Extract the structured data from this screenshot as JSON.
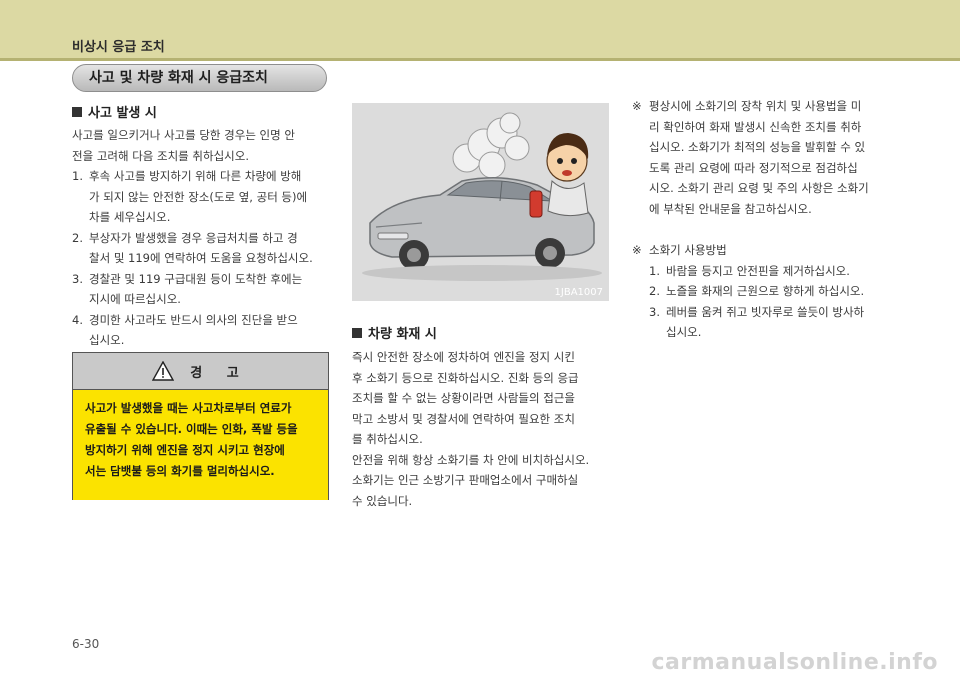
{
  "header": {
    "title": "비상시 응급 조치"
  },
  "section_title": "사고 및 차량 화재 시 응급조치",
  "accident": {
    "heading": "사고 발생 시",
    "intro": [
      "사고를 일으키거나 사고를 당한 경우는 인명 안",
      "전을 고려해 다음 조치를 취하십시오."
    ],
    "items": [
      {
        "num": "1.",
        "lines": [
          "후속 사고를 방지하기 위해 다른 차량에 방해",
          "가 되지 않는 안전한 장소(도로 옆, 공터 등)에",
          "차를 세우십시오."
        ]
      },
      {
        "num": "2.",
        "lines": [
          "부상자가 발생했을 경우 응급처치를 하고 경",
          "찰서 및 119에 연락하여 도움을 요청하십시오."
        ]
      },
      {
        "num": "3.",
        "lines": [
          "경찰관 및 119 구급대원 등이 도착한 후에는",
          "지시에 따르십시오."
        ]
      },
      {
        "num": "4.",
        "lines": [
          "경미한 사고라도 반드시 의사의 진단을 받으",
          "십시오."
        ]
      }
    ]
  },
  "warning": {
    "title": "경 고",
    "lines": [
      "사고가 발생했을 때는 사고차로부터 연료가",
      "유출될 수 있습니다. 이때는 인화, 폭발 등을",
      "방지하기 위해 엔진을 정지 시키고 현장에",
      "서는 담뱃불 등의 화기를 멀리하십시오."
    ]
  },
  "image": {
    "code": "1JBA1007"
  },
  "fire": {
    "heading": "차량 화재 시",
    "lines": [
      "즉시 안전한 장소에 정차하여 엔진을 정지 시킨",
      "후 소화기 등으로 진화하십시오. 진화 등의 응급",
      "조치를 할 수 없는 상황이라면 사람들의 접근을",
      "막고 소방서 및 경찰서에 연락하여 필요한 조치",
      "를 취하십시오.",
      "안전을 위해 항상 소화기를 차 안에 비치하십시오.",
      "소화기는 인근 소방기구 판매업소에서 구매하실",
      "수 있습니다."
    ]
  },
  "note1": {
    "mark": "※",
    "lines": [
      "평상시에 소화기의 장착 위치 및 사용법을 미",
      "리 확인하여 화재 발생시 신속한 조치를 취하",
      "십시오. 소화기가 최적의 성능을 발휘할 수 있",
      "도록 관리 요령에 따라 정기적으로 점검하십",
      "시오. 소화기 관리 요령 및 주의 사항은 소화기",
      "에 부착된 안내문을 참고하십시오."
    ]
  },
  "note2": {
    "mark": "※",
    "title": "소화기 사용방법",
    "items": [
      {
        "num": "1.",
        "lines": [
          "바람을 등지고 안전핀을 제거하십시오."
        ]
      },
      {
        "num": "2.",
        "lines": [
          "노즐을 화재의 근원으로 향하게 하십시오."
        ]
      },
      {
        "num": "3.",
        "lines": [
          "레버를 움켜 쥐고 빗자루로 쓸듯이 방사하",
          "십시오."
        ]
      }
    ]
  },
  "page_number": "6-30",
  "watermark": "carmanualsonline.info",
  "colors": {
    "header_band": "#dcd9a3",
    "warning_fill": "#fbe300",
    "warning_head": "#c9c9c9"
  }
}
